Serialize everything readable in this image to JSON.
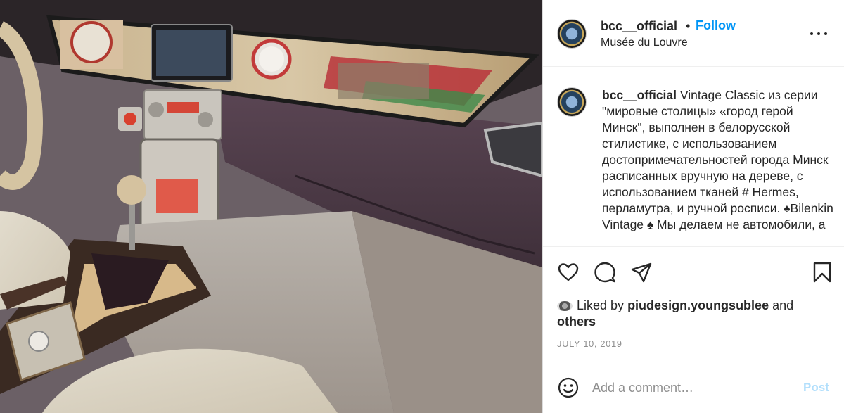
{
  "post": {
    "photo_alt": "Car interior dashboard",
    "header": {
      "username": "bcc__official",
      "separator": "•",
      "follow_label": "Follow",
      "location": "Musée du Louvre",
      "more_icon": "more-options-icon"
    },
    "caption": {
      "username": "bcc__official",
      "text": " Vintage Classic из серии \"мировые столицы» «город герой Минск\", выполнен в белорусской стилистике, с использованием достопримечательностей города Минск расписанных вручную на дереве, с использованием тканей # Hermes, перламутра, и ручной росписи. ♠Bilenkin Vintage ♠ Мы делаем не автомобили, а"
    },
    "actions": {
      "like_icon": "heart-icon",
      "comment_icon": "comment-icon",
      "share_icon": "share-icon",
      "save_icon": "bookmark-icon"
    },
    "likes": {
      "prefix": "Liked by",
      "liker": "piudesign.youngsublee",
      "conj": "and",
      "others": "others"
    },
    "date": "JULY 10, 2019",
    "comment": {
      "emoji_icon": "emoji-icon",
      "placeholder": "Add a comment…",
      "post_label": "Post"
    }
  },
  "colors": {
    "accent": "#0095f6",
    "post_disabled": "#b2dffc",
    "muted": "#8e8e8e",
    "text": "#262626"
  }
}
